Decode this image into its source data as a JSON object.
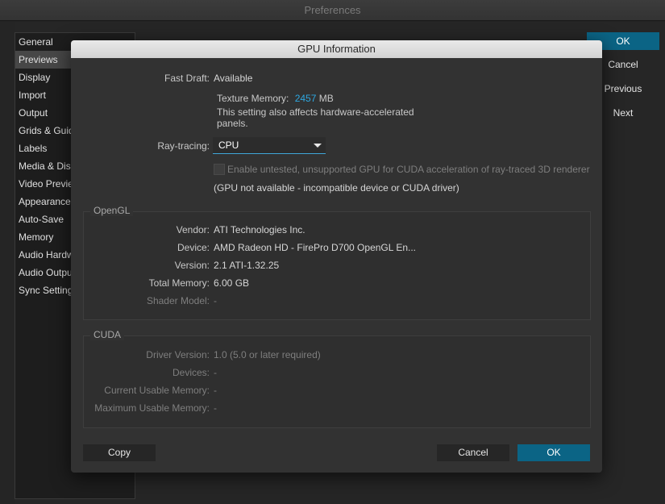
{
  "preferences": {
    "title": "Preferences",
    "sidebar": [
      {
        "label": "General"
      },
      {
        "label": "Previews"
      },
      {
        "label": "Display"
      },
      {
        "label": "Import"
      },
      {
        "label": "Output"
      },
      {
        "label": "Grids & Guid"
      },
      {
        "label": "Labels"
      },
      {
        "label": "Media & Disk"
      },
      {
        "label": "Video Previe"
      },
      {
        "label": "Appearance"
      },
      {
        "label": "Auto-Save"
      },
      {
        "label": "Memory"
      },
      {
        "label": "Audio Hardw"
      },
      {
        "label": "Audio Outpu"
      },
      {
        "label": "Sync Setting"
      }
    ],
    "selected": "Previews",
    "buttons": {
      "ok": "OK",
      "cancel": "Cancel",
      "previous": "Previous",
      "next": "Next"
    }
  },
  "dialog": {
    "title": "GPU Information",
    "fast_draft": {
      "label": "Fast Draft:",
      "value": "Available"
    },
    "texture_memory": {
      "label": "Texture Memory:",
      "value": "2457",
      "unit": "MB"
    },
    "note_line1": "This setting also affects hardware-accelerated",
    "note_line2": "panels.",
    "ray_tracing": {
      "label": "Ray-tracing:",
      "value": "CPU"
    },
    "checkbox_label": "Enable untested, unsupported GPU for CUDA acceleration of ray-traced 3D renderer",
    "gpu_status": "(GPU not available - incompatible device or CUDA driver)",
    "opengl": {
      "title": "OpenGL",
      "rows": [
        {
          "label": "Vendor:",
          "value": "ATI Technologies Inc."
        },
        {
          "label": "Device:",
          "value": "AMD Radeon HD - FirePro D700 OpenGL En..."
        },
        {
          "label": "Version:",
          "value": "2.1 ATI-1.32.25"
        },
        {
          "label": "Total Memory:",
          "value": "6.00 GB"
        },
        {
          "label": "Shader Model:",
          "value": "-"
        }
      ]
    },
    "cuda": {
      "title": "CUDA",
      "rows": [
        {
          "label": "Driver Version:",
          "value": "1.0 (5.0 or later required)"
        },
        {
          "label": "Devices:",
          "value": "-"
        },
        {
          "label": "Current Usable Memory:",
          "value": "-"
        },
        {
          "label": "Maximum Usable Memory:",
          "value": "-"
        }
      ]
    },
    "buttons": {
      "copy": "Copy",
      "cancel": "Cancel",
      "ok": "OK"
    }
  },
  "colors": {
    "accent": "#2ea7e0",
    "primary_button": "#0b6485",
    "background": "#323232"
  }
}
